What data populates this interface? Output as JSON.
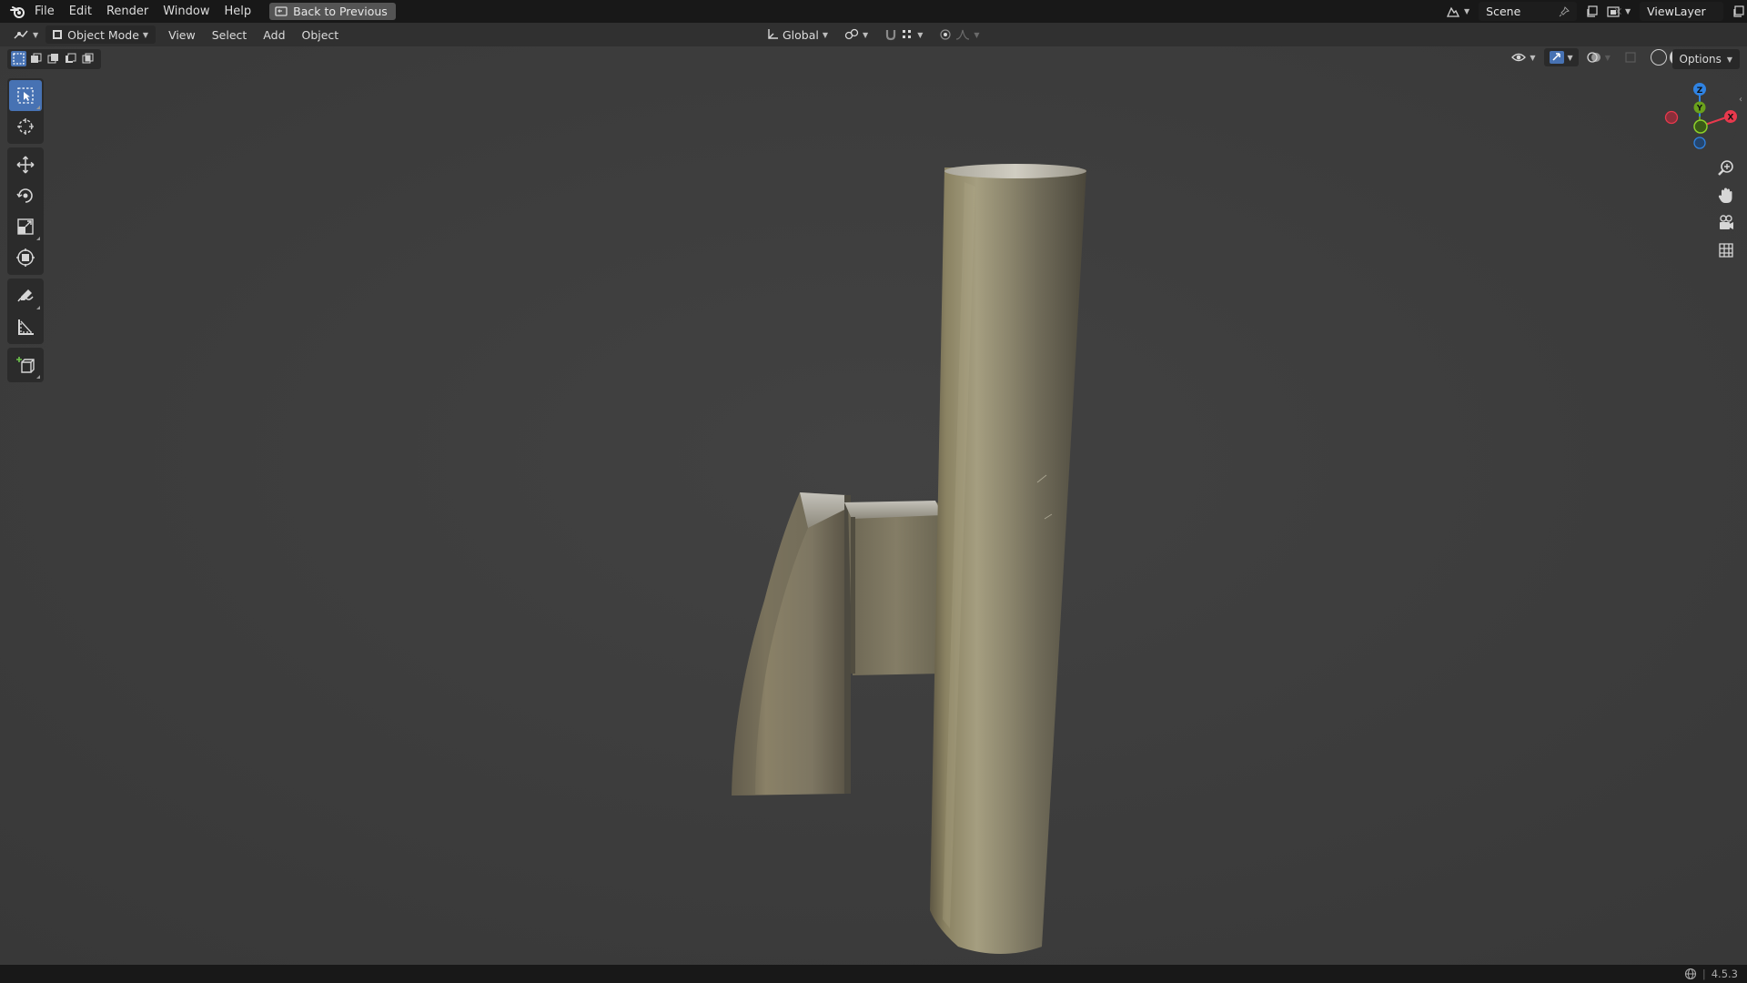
{
  "menubar": {
    "items": [
      "File",
      "Edit",
      "Render",
      "Window",
      "Help"
    ],
    "back_button": "Back to Previous",
    "scene_name": "Scene",
    "view_layer": "ViewLayer"
  },
  "header": {
    "mode": "Object Mode",
    "menus": [
      "View",
      "Select",
      "Add",
      "Object"
    ],
    "transform_orientation": "Global"
  },
  "options_label": "Options",
  "toolbar": {
    "tools": [
      "select-box-icon",
      "cursor-icon",
      "move-icon",
      "rotate-icon",
      "scale-icon",
      "transform-icon",
      "annotate-icon",
      "measure-icon",
      "add-cube-icon"
    ],
    "active_tool": "select-box-icon"
  },
  "gizmo": {
    "z_label": "Z",
    "y_label": "Y",
    "x_label": "X",
    "colors": {
      "x": "#e8394d",
      "y": "#6aa11c",
      "z": "#2f83e3"
    }
  },
  "statusbar": {
    "version": "4.5.3"
  },
  "colors": {
    "accent": "#4772b3",
    "viewport_bg": "#3d3d3d",
    "topbar_bg": "#181818"
  }
}
